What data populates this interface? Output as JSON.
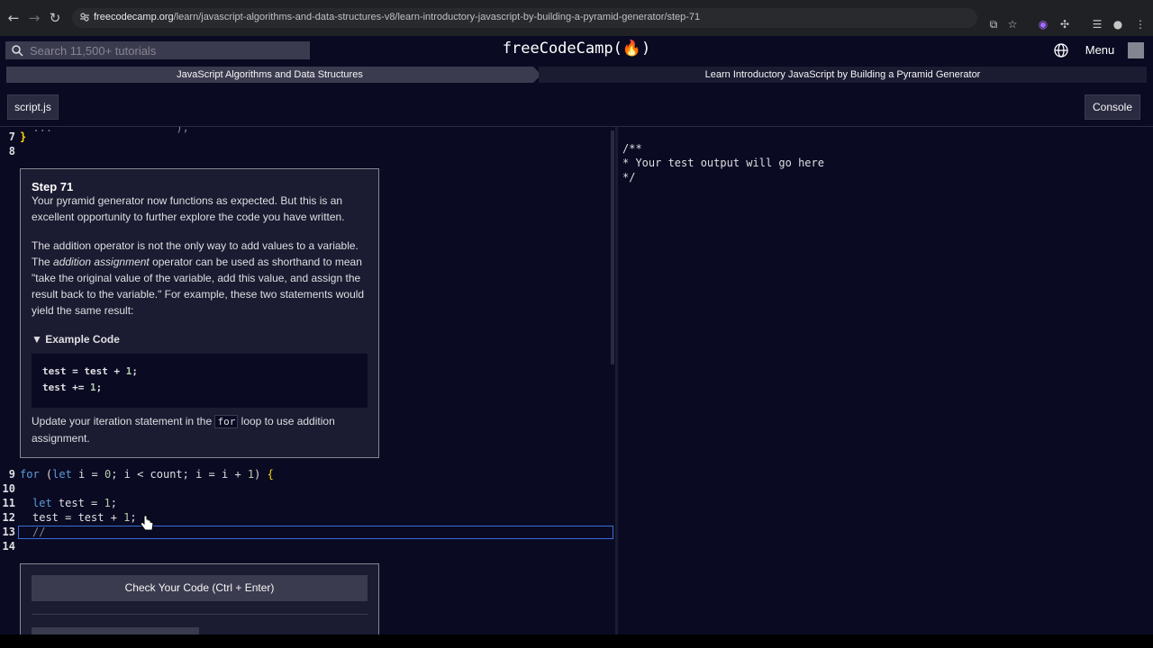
{
  "browser": {
    "url_host": "freecodecamp.org",
    "url_path": "/learn/javascript-algorithms-and-data-structures-v8/learn-introductory-javascript-by-building-a-pyramid-generator/step-71"
  },
  "nav": {
    "search_placeholder": "Search 11,500+ tutorials",
    "logo": "freeCodeCamp(🔥)",
    "menu_label": "Menu"
  },
  "breadcrumb": {
    "superblock": "JavaScript Algorithms and Data Structures",
    "block": "Learn Introductory JavaScript by Building a Pyramid Generator"
  },
  "toolbar": {
    "file_tab": "script.js",
    "console_button": "Console"
  },
  "editor": {
    "top_lines": [
      {
        "n": "7",
        "code": "}"
      },
      {
        "n": "8",
        "code": ""
      }
    ],
    "bottom_lines": [
      {
        "n": "9"
      },
      {
        "n": "10"
      },
      {
        "n": "11"
      },
      {
        "n": "12"
      },
      {
        "n": "13"
      },
      {
        "n": "14"
      }
    ],
    "line9": {
      "kw_for": "for",
      "p1": " (",
      "kw_let": "let",
      "p2": " i = ",
      "n0": "0",
      "p3": "; i < count; i = i + ",
      "n1": "1",
      "p4": ") ",
      "brace": "{"
    },
    "line11": {
      "kw": "let",
      "rest": " test = ",
      "num": "1",
      "end": ";"
    },
    "line12": {
      "pre": "test = test + ",
      "num": "1",
      "end": ";"
    },
    "line13": "//"
  },
  "step": {
    "title": "Step 71",
    "para1": "Your pyramid generator now functions as expected. But this is an excellent opportunity to further explore the code you have written.",
    "para2_a": "The addition operator is not the only way to add values to a variable. The ",
    "para2_em": "addition assignment",
    "para2_b": " operator can be used as shorthand to mean \"take the original value of the variable, add this value, and assign the result back to the variable.\" For example, these two statements would yield the same result:",
    "example_summary": "▼ Example Code",
    "example_line1": {
      "a": "test = test + ",
      "n": "1",
      "e": ";"
    },
    "example_line2": {
      "a": "test += ",
      "n": "1",
      "e": ";"
    },
    "para3_a": "Update your iteration statement in the ",
    "para3_code": "for",
    "para3_b": " loop to use addition assignment."
  },
  "actions": {
    "check_button": "Check Your Code (Ctrl + Enter)"
  },
  "preview": {
    "lines": [
      "/**",
      "* Your test output will go here",
      "*/"
    ]
  }
}
